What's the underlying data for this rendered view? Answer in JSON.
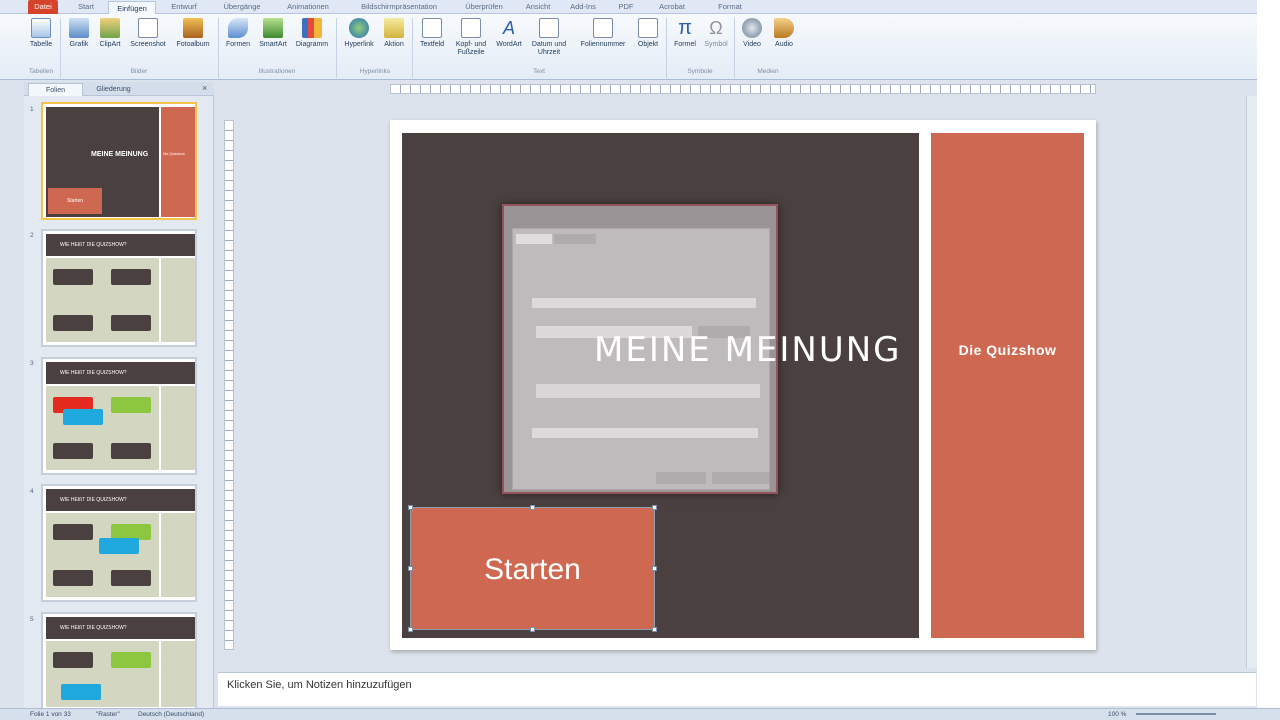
{
  "tabs": [
    "Datei",
    "Start",
    "Einfügen",
    "Entwurf",
    "Übergänge",
    "Animationen",
    "Bildschirmpräsentation",
    "Überprüfen",
    "Ansicht",
    "Add-Ins",
    "PDF",
    "Acrobat",
    "Format"
  ],
  "ribbon": {
    "buttons": [
      "Tabelle",
      "Grafik",
      "ClipArt",
      "Screenshot",
      "Fotoalbum",
      "Formen",
      "SmartArt",
      "Diagramm",
      "Hyperlink",
      "Aktion",
      "Textfeld",
      "Kopf- und Fußzeile",
      "WordArt",
      "Datum und Uhrzeit",
      "Foliennummer",
      "Objekt",
      "Formel",
      "Symbol",
      "Video",
      "Audio"
    ],
    "groups": [
      "Tabellen",
      "Bilder",
      "Illustrationen",
      "Hyperlinks",
      "Text",
      "Symbole",
      "Medien"
    ]
  },
  "leftpane": {
    "tabs": [
      "Folien",
      "Gliederung"
    ],
    "thumbs": [
      {
        "num": "1",
        "title": "MEINE MEINUNG",
        "side": "Die Quizshow",
        "btn": "Starten"
      },
      {
        "num": "2",
        "head": "WIE HEIßT DIE QUIZSHOW?"
      },
      {
        "num": "3",
        "head": "WIE HEIßT DIE QUIZSHOW?"
      },
      {
        "num": "4",
        "head": "WIE HEIßT DIE QUIZSHOW?"
      },
      {
        "num": "5",
        "head": "WIE HEIßT DIE QUIZSHOW?"
      }
    ]
  },
  "slide": {
    "title": "MEINE MEINUNG",
    "subtitle": "Die Quizshow",
    "button": "Starten"
  },
  "notes": "Klicken Sie, um Notizen hinzuzufügen",
  "status": {
    "slide": "Folie 1 von 33",
    "theme": "\"Raster\"",
    "lang": "Deutsch (Deutschland)",
    "zoom": "100 %"
  },
  "colors": {
    "dark": "#4a4040",
    "orange": "#cf6851",
    "file_tab": "#d5442a"
  }
}
